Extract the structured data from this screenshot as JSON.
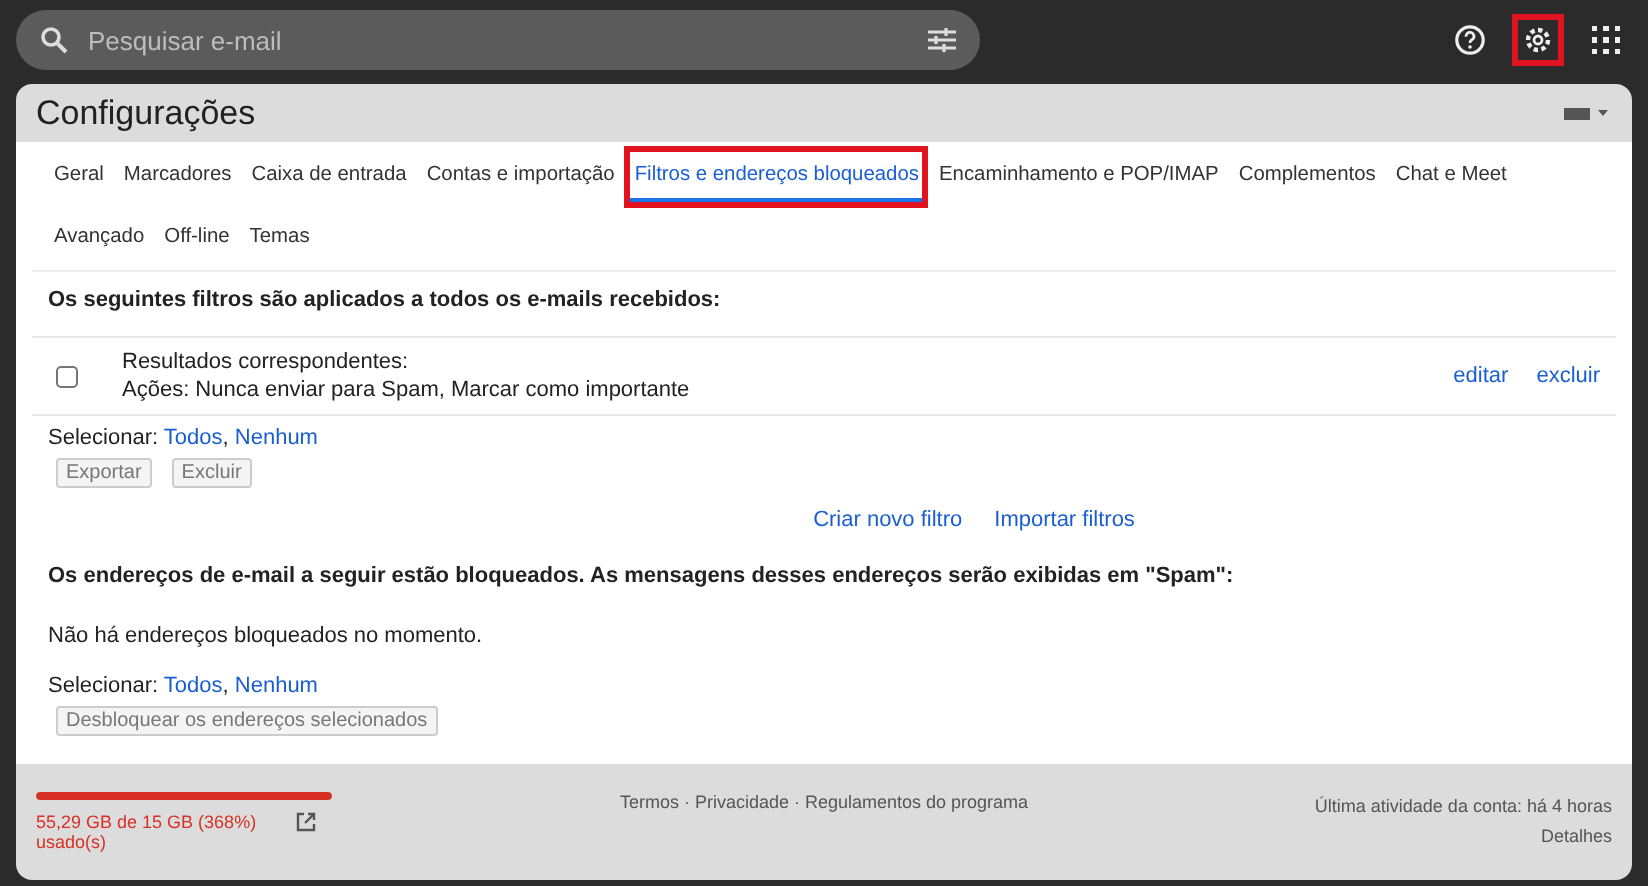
{
  "search": {
    "placeholder": "Pesquisar e-mail"
  },
  "top_icons": {
    "settings_highlighted": true
  },
  "title": "Configurações",
  "tabs": [
    {
      "label": "Geral",
      "selected": false,
      "highlighted": false
    },
    {
      "label": "Marcadores",
      "selected": false,
      "highlighted": false
    },
    {
      "label": "Caixa de entrada",
      "selected": false,
      "highlighted": false
    },
    {
      "label": "Contas e importação",
      "selected": false,
      "highlighted": false
    },
    {
      "label": "Filtros e endereços bloqueados",
      "selected": true,
      "highlighted": true
    },
    {
      "label": "Encaminhamento e POP/IMAP",
      "selected": false,
      "highlighted": false
    },
    {
      "label": "Complementos",
      "selected": false,
      "highlighted": false
    },
    {
      "label": "Chat e Meet",
      "selected": false,
      "highlighted": false
    },
    {
      "label": "Avançado",
      "selected": false,
      "highlighted": false
    },
    {
      "label": "Off-line",
      "selected": false,
      "highlighted": false
    },
    {
      "label": "Temas",
      "selected": false,
      "highlighted": false
    }
  ],
  "filters": {
    "heading": "Os seguintes filtros são aplicados a todos os e-mails recebidos:",
    "rows": [
      {
        "checked": false,
        "match": "Resultados correspondentes:",
        "actions": "Ações: Nunca enviar para Spam, Marcar como importante",
        "links": [
          "editar",
          "excluir"
        ]
      }
    ],
    "select_label": "Selecionar:",
    "select_links": [
      "Todos",
      "Nenhum"
    ],
    "select_separator": ",",
    "buttons": [
      "Exportar",
      "Excluir"
    ],
    "bottom_links": [
      "Criar novo filtro",
      "Importar filtros"
    ]
  },
  "blocked": {
    "heading": "Os endereços de e-mail a seguir estão bloqueados. As mensagens desses endereços serão exibidas em \"Spam\":",
    "empty_text": "Não há endereços bloqueados no momento.",
    "select_label": "Selecionar:",
    "select_links": [
      "Todos",
      "Nenhum"
    ],
    "select_separator": ",",
    "button": "Desbloquear os endereços selecionados"
  },
  "footer": {
    "storage": {
      "level": 1,
      "text": "55,29 GB de 15 GB (368%) usado(s)"
    },
    "links": "Termos · Privacidade · Regulamentos do programa",
    "activity": "Última atividade da conta: há 4 horas",
    "details": "Detalhes"
  }
}
